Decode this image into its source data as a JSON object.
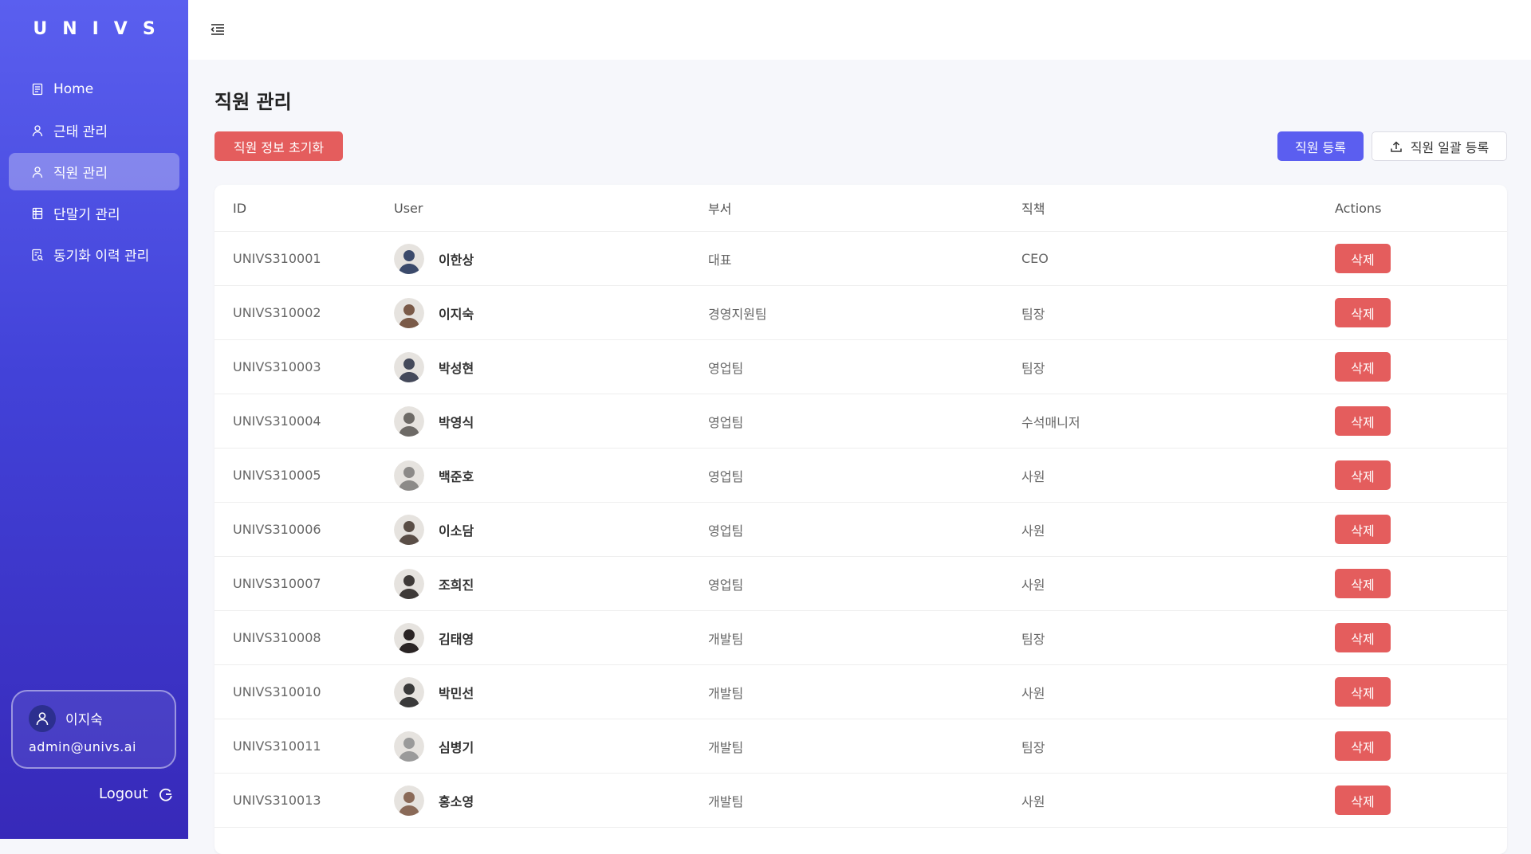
{
  "app": {
    "logo": "UNIVS"
  },
  "sidebar": {
    "items": [
      {
        "label": "Home",
        "icon": "document-icon",
        "active": false
      },
      {
        "label": "근태 관리",
        "icon": "person-icon",
        "active": false
      },
      {
        "label": "직원 관리",
        "icon": "person-icon",
        "active": true
      },
      {
        "label": "단말기 관리",
        "icon": "device-list-icon",
        "active": false
      },
      {
        "label": "동기화 이력 관리",
        "icon": "search-document-icon",
        "active": false
      }
    ],
    "user": {
      "name": "이지숙",
      "email": "admin@univs.ai"
    },
    "logout_label": "Logout"
  },
  "main": {
    "title": "직원 관리",
    "reset_button": "직원 정보 초기화",
    "register_button": "직원 등록",
    "bulk_register_button": "직원 일괄 등록",
    "table": {
      "headers": {
        "id": "ID",
        "user": "User",
        "dept": "부서",
        "position": "직책",
        "actions": "Actions"
      },
      "delete_label": "삭제",
      "rows": [
        {
          "id": "UNIVS310001",
          "name": "이한상",
          "dept": "대표",
          "position": "CEO",
          "avatar": "#3b4a6b"
        },
        {
          "id": "UNIVS310002",
          "name": "이지숙",
          "dept": "경영지원팀",
          "position": "팀장",
          "avatar": "#7a5a48"
        },
        {
          "id": "UNIVS310003",
          "name": "박성현",
          "dept": "영업팀",
          "position": "팀장",
          "avatar": "#44495a"
        },
        {
          "id": "UNIVS310004",
          "name": "박영식",
          "dept": "영업팀",
          "position": "수석매니저",
          "avatar": "#6d6a66"
        },
        {
          "id": "UNIVS310005",
          "name": "백준호",
          "dept": "영업팀",
          "position": "사원",
          "avatar": "#8c8a88"
        },
        {
          "id": "UNIVS310006",
          "name": "이소담",
          "dept": "영업팀",
          "position": "사원",
          "avatar": "#5a4e47"
        },
        {
          "id": "UNIVS310007",
          "name": "조희진",
          "dept": "영업팀",
          "position": "사원",
          "avatar": "#3e3a38"
        },
        {
          "id": "UNIVS310008",
          "name": "김태영",
          "dept": "개발팀",
          "position": "팀장",
          "avatar": "#2a2424"
        },
        {
          "id": "UNIVS310010",
          "name": "박민선",
          "dept": "개발팀",
          "position": "사원",
          "avatar": "#3a3a3a"
        },
        {
          "id": "UNIVS310011",
          "name": "심병기",
          "dept": "개발팀",
          "position": "팀장",
          "avatar": "#9a9a9a"
        },
        {
          "id": "UNIVS310013",
          "name": "홍소영",
          "dept": "개발팀",
          "position": "사원",
          "avatar": "#8a6a58"
        }
      ]
    }
  }
}
